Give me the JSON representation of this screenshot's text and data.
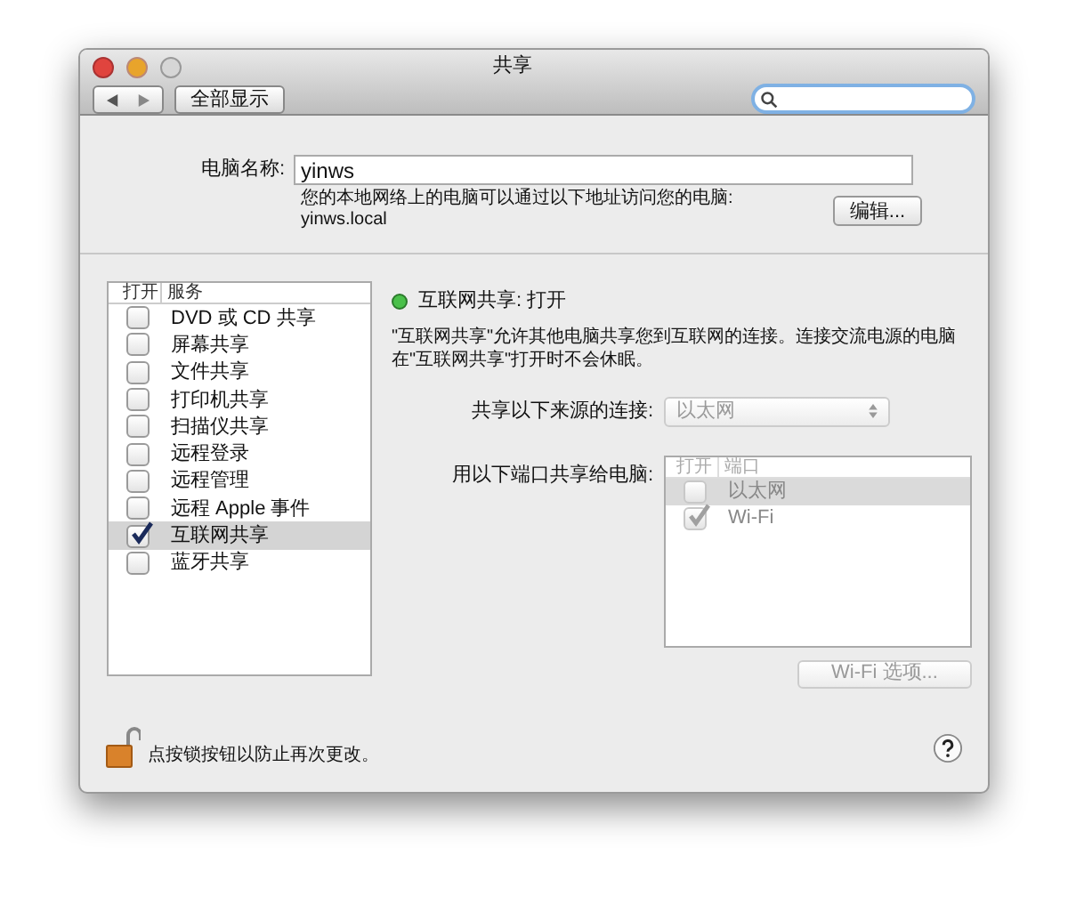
{
  "window": {
    "title": "共享"
  },
  "toolbar": {
    "show_all": "全部显示"
  },
  "computer_name": {
    "label": "电脑名称:",
    "value": "yinws",
    "hint": "您的本地网络上的电脑可以通过以下地址访问您的电脑:",
    "address": "yinws.local",
    "edit_button": "编辑..."
  },
  "services": {
    "columns": [
      "打开",
      "服务"
    ],
    "rows": [
      {
        "name": "DVD 或 CD 共享",
        "checked": false,
        "selected": false
      },
      {
        "name": "屏幕共享",
        "checked": false,
        "selected": false
      },
      {
        "name": "文件共享",
        "checked": false,
        "selected": false
      },
      {
        "name": "打印机共享",
        "checked": false,
        "selected": false
      },
      {
        "name": "扫描仪共享",
        "checked": false,
        "selected": false
      },
      {
        "name": "远程登录",
        "checked": false,
        "selected": false
      },
      {
        "name": "远程管理",
        "checked": false,
        "selected": false
      },
      {
        "name": "远程 Apple 事件",
        "checked": false,
        "selected": false
      },
      {
        "name": "互联网共享",
        "checked": true,
        "selected": true
      },
      {
        "name": "蓝牙共享",
        "checked": false,
        "selected": false
      }
    ]
  },
  "detail": {
    "status": {
      "label": "互联网共享: 打开",
      "on": true
    },
    "description": "\"互联网共享\"允许其他电脑共享您到互联网的连接。连接交流电源的电脑在\"互联网共享\"打开时不会休眠。",
    "share_from": {
      "label": "共享以下来源的连接:",
      "value": "以太网",
      "disabled": true
    },
    "share_to": {
      "label": "用以下端口共享给电脑:",
      "disabled": true,
      "columns": [
        "打开",
        "端口"
      ],
      "rows": [
        {
          "name": "以太网",
          "checked": false,
          "selected": true
        },
        {
          "name": "Wi-Fi",
          "checked": true,
          "selected": false
        }
      ]
    },
    "wifi_button": {
      "label": "Wi-Fi 选项...",
      "disabled": true
    }
  },
  "footer": {
    "text": "点按锁按钮以防止再次更改。",
    "locked": false
  }
}
